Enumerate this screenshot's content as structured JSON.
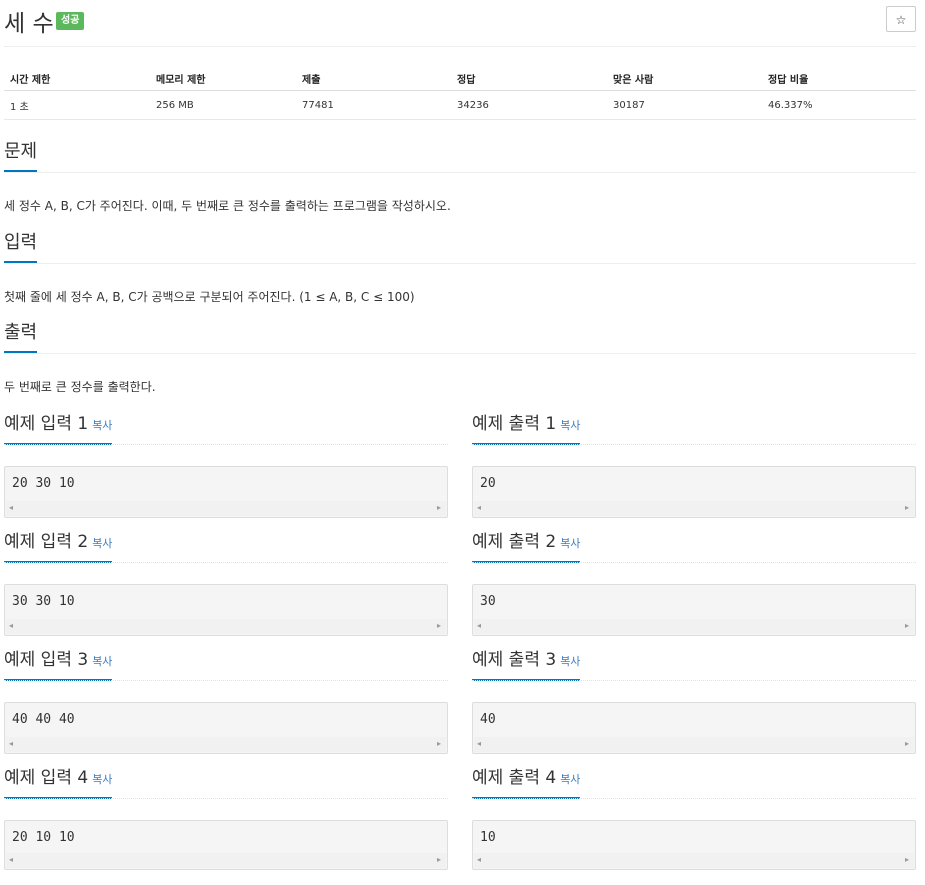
{
  "title": "세 수",
  "badge": "성공",
  "star_glyph": "☆",
  "info": {
    "headers": [
      "시간 제한",
      "메모리 제한",
      "제출",
      "정답",
      "맞은 사람",
      "정답 비율"
    ],
    "values": [
      "1 초",
      "256 MB",
      "77481",
      "34236",
      "30187",
      "46.337%"
    ]
  },
  "problem": {
    "heading": "문제",
    "text": "세 정수 A, B, C가 주어진다. 이때, 두 번째로 큰 정수를 출력하는 프로그램을 작성하시오."
  },
  "input": {
    "heading": "입력",
    "text": "첫째 줄에 세 정수 A, B, C가 공백으로 구분되어 주어진다. (1 ≤ A, B, C ≤ 100)"
  },
  "output": {
    "heading": "출력",
    "text": "두 번째로 큰 정수를 출력한다."
  },
  "copy_label": "복사",
  "samples": [
    {
      "in_label": "예제 입력 1",
      "in": "20 30 10",
      "out_label": "예제 출력 1",
      "out": "20"
    },
    {
      "in_label": "예제 입력 2",
      "in": "30 30 10",
      "out_label": "예제 출력 2",
      "out": "30"
    },
    {
      "in_label": "예제 입력 3",
      "in": "40 40 40",
      "out_label": "예제 출력 3",
      "out": "40"
    },
    {
      "in_label": "예제 입력 4",
      "in": "20 10 10",
      "out_label": "예제 출력 4",
      "out": "10"
    }
  ],
  "scroll": {
    "left": "◂",
    "right": "▸"
  }
}
